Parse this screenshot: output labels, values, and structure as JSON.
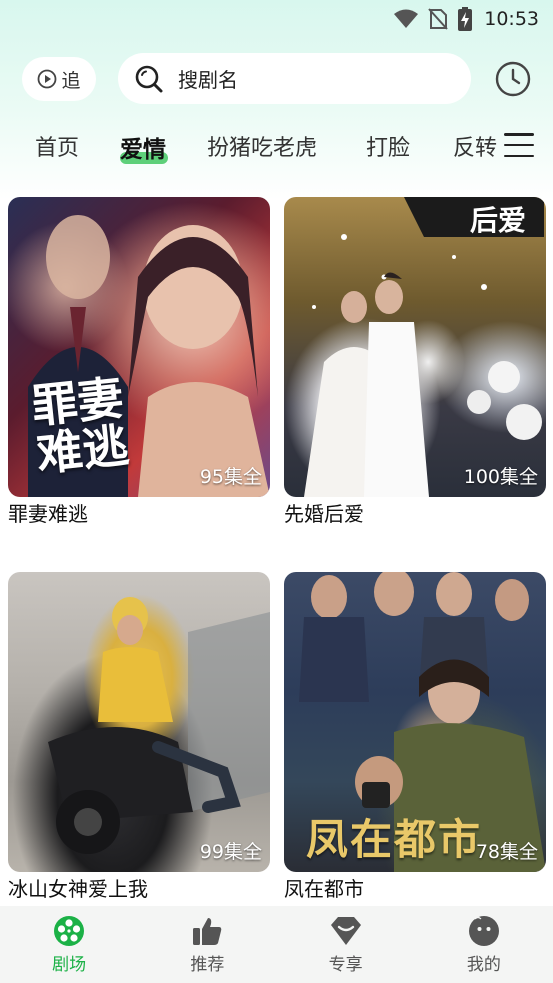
{
  "status_bar": {
    "time": "10:53"
  },
  "header": {
    "follow_label": "追",
    "search_placeholder": "搜剧名"
  },
  "tabs": [
    {
      "label": "首页",
      "active": false
    },
    {
      "label": "爱情",
      "active": true
    },
    {
      "label": "扮猪吃老虎",
      "active": false
    },
    {
      "label": "打脸",
      "active": false
    },
    {
      "label": "反转",
      "active": false
    }
  ],
  "dramas": [
    {
      "title": "罪妻难逃",
      "episodes": "95集全",
      "poster_text": "罪妻难逃"
    },
    {
      "title": "先婚后爱",
      "episodes": "100集全",
      "poster_text": "后爱"
    },
    {
      "title": "冰山女神爱上我",
      "episodes": "99集全",
      "poster_text": ""
    },
    {
      "title": "凤在都市",
      "episodes": "78集全",
      "poster_text": "凤在都市"
    }
  ],
  "bottom_nav": [
    {
      "label": "剧场",
      "icon": "film-reel-icon",
      "active": true
    },
    {
      "label": "推荐",
      "icon": "thumbs-up-icon",
      "active": false
    },
    {
      "label": "专享",
      "icon": "diamond-icon",
      "active": false
    },
    {
      "label": "我的",
      "icon": "face-icon",
      "active": false
    }
  ],
  "colors": {
    "accent": "#1bb146",
    "tab_underline": "#5ed07a"
  }
}
